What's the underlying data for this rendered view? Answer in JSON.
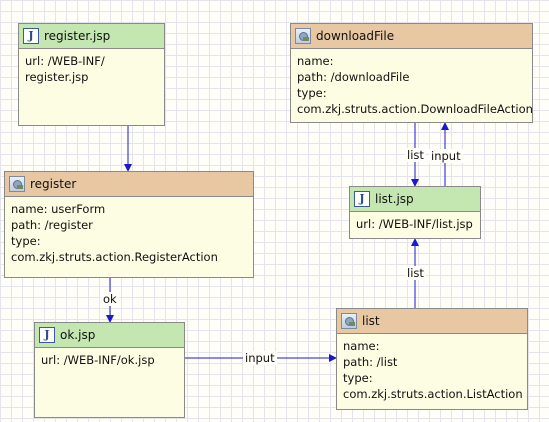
{
  "nodes": {
    "register_jsp": {
      "title": "register.jsp",
      "icon": "jsp-file-icon",
      "body": "url: /WEB-INF/\nregister.jsp"
    },
    "register": {
      "title": "register",
      "icon": "struts-action-icon",
      "body": "name: userForm\npath: /register\ntype: com.zkj.struts.action.RegisterAction"
    },
    "ok_jsp": {
      "title": "ok.jsp",
      "icon": "jsp-file-icon",
      "body": "url: /WEB-INF/ok.jsp"
    },
    "downloadFile": {
      "title": "downloadFile",
      "icon": "struts-action-icon",
      "body": "name:\npath: /downloadFile\ntype:\ncom.zkj.struts.action.DownloadFileAction"
    },
    "list_jsp": {
      "title": "list.jsp",
      "icon": "jsp-file-icon",
      "body": "url: /WEB-INF/list.jsp"
    },
    "list": {
      "title": "list",
      "icon": "struts-action-icon",
      "body": "name:\npath: /list\ntype:\ncom.zkj.struts.action.ListAction"
    }
  },
  "edges": {
    "register_jsp_to_register": {
      "label": ""
    },
    "register_to_ok": {
      "label": "ok"
    },
    "ok_to_list": {
      "label": "input"
    },
    "list_to_list_jsp": {
      "label": "list"
    },
    "download_to_list_jsp": {
      "label": "list"
    },
    "list_jsp_to_download": {
      "label": "input"
    }
  },
  "colors": {
    "edge": "#1a1acc",
    "jsp_header": "#c4e6b0",
    "action_header": "#e8c8a2",
    "node_body": "#fdfde4"
  }
}
